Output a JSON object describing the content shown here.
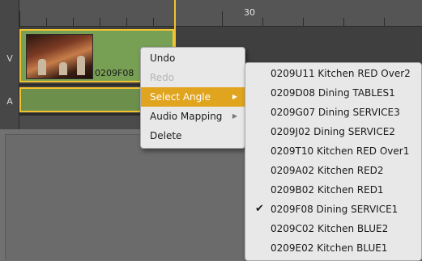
{
  "timeline": {
    "ruler_label": "30",
    "tracks": [
      "V",
      "A"
    ],
    "clip_name": "0209F08"
  },
  "context_menu": {
    "items": [
      {
        "label": "Undo",
        "enabled": true
      },
      {
        "label": "Redo",
        "enabled": false
      },
      {
        "label": "Select Angle",
        "enabled": true,
        "submenu": true,
        "active": true
      },
      {
        "label": "Audio Mapping",
        "enabled": true,
        "submenu": true
      },
      {
        "label": "Delete",
        "enabled": true
      }
    ],
    "submenu_arrow_icon": "triangle-right-icon",
    "active_color": "#e0a41f"
  },
  "angle_submenu": {
    "items": [
      "0209U11 Kitchen RED Over2",
      "0209D08 Dining TABLES1",
      "0209G07 Dining SERVICE3",
      "0209J02 Dining SERVICE2",
      "0209T10 Kitchen RED Over1",
      "0209A02 Kitchen RED2",
      "0209B02 Kitchen RED1",
      "0209F08 Dining SERVICE1",
      "0209C02 Kitchen BLUE2",
      "0209E02 Kitchen BLUE1"
    ],
    "checked_index": 7,
    "check_mark": "✔"
  }
}
